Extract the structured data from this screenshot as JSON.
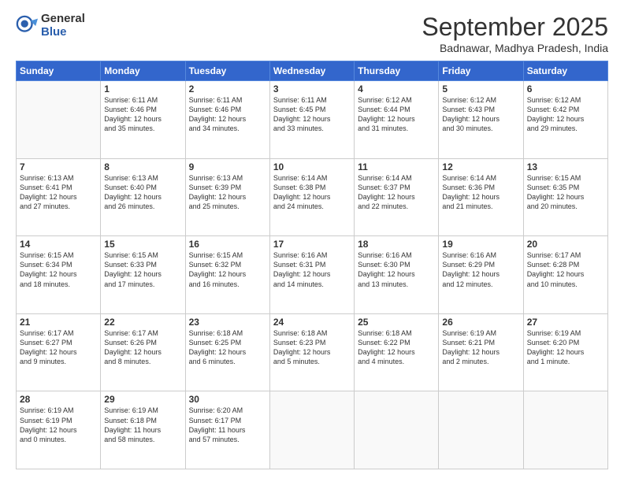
{
  "logo": {
    "general": "General",
    "blue": "Blue"
  },
  "title": "September 2025",
  "location": "Badnawar, Madhya Pradesh, India",
  "days_header": [
    "Sunday",
    "Monday",
    "Tuesday",
    "Wednesday",
    "Thursday",
    "Friday",
    "Saturday"
  ],
  "weeks": [
    [
      {
        "day": "",
        "info": ""
      },
      {
        "day": "1",
        "info": "Sunrise: 6:11 AM\nSunset: 6:46 PM\nDaylight: 12 hours\nand 35 minutes."
      },
      {
        "day": "2",
        "info": "Sunrise: 6:11 AM\nSunset: 6:46 PM\nDaylight: 12 hours\nand 34 minutes."
      },
      {
        "day": "3",
        "info": "Sunrise: 6:11 AM\nSunset: 6:45 PM\nDaylight: 12 hours\nand 33 minutes."
      },
      {
        "day": "4",
        "info": "Sunrise: 6:12 AM\nSunset: 6:44 PM\nDaylight: 12 hours\nand 31 minutes."
      },
      {
        "day": "5",
        "info": "Sunrise: 6:12 AM\nSunset: 6:43 PM\nDaylight: 12 hours\nand 30 minutes."
      },
      {
        "day": "6",
        "info": "Sunrise: 6:12 AM\nSunset: 6:42 PM\nDaylight: 12 hours\nand 29 minutes."
      }
    ],
    [
      {
        "day": "7",
        "info": "Sunrise: 6:13 AM\nSunset: 6:41 PM\nDaylight: 12 hours\nand 27 minutes."
      },
      {
        "day": "8",
        "info": "Sunrise: 6:13 AM\nSunset: 6:40 PM\nDaylight: 12 hours\nand 26 minutes."
      },
      {
        "day": "9",
        "info": "Sunrise: 6:13 AM\nSunset: 6:39 PM\nDaylight: 12 hours\nand 25 minutes."
      },
      {
        "day": "10",
        "info": "Sunrise: 6:14 AM\nSunset: 6:38 PM\nDaylight: 12 hours\nand 24 minutes."
      },
      {
        "day": "11",
        "info": "Sunrise: 6:14 AM\nSunset: 6:37 PM\nDaylight: 12 hours\nand 22 minutes."
      },
      {
        "day": "12",
        "info": "Sunrise: 6:14 AM\nSunset: 6:36 PM\nDaylight: 12 hours\nand 21 minutes."
      },
      {
        "day": "13",
        "info": "Sunrise: 6:15 AM\nSunset: 6:35 PM\nDaylight: 12 hours\nand 20 minutes."
      }
    ],
    [
      {
        "day": "14",
        "info": "Sunrise: 6:15 AM\nSunset: 6:34 PM\nDaylight: 12 hours\nand 18 minutes."
      },
      {
        "day": "15",
        "info": "Sunrise: 6:15 AM\nSunset: 6:33 PM\nDaylight: 12 hours\nand 17 minutes."
      },
      {
        "day": "16",
        "info": "Sunrise: 6:15 AM\nSunset: 6:32 PM\nDaylight: 12 hours\nand 16 minutes."
      },
      {
        "day": "17",
        "info": "Sunrise: 6:16 AM\nSunset: 6:31 PM\nDaylight: 12 hours\nand 14 minutes."
      },
      {
        "day": "18",
        "info": "Sunrise: 6:16 AM\nSunset: 6:30 PM\nDaylight: 12 hours\nand 13 minutes."
      },
      {
        "day": "19",
        "info": "Sunrise: 6:16 AM\nSunset: 6:29 PM\nDaylight: 12 hours\nand 12 minutes."
      },
      {
        "day": "20",
        "info": "Sunrise: 6:17 AM\nSunset: 6:28 PM\nDaylight: 12 hours\nand 10 minutes."
      }
    ],
    [
      {
        "day": "21",
        "info": "Sunrise: 6:17 AM\nSunset: 6:27 PM\nDaylight: 12 hours\nand 9 minutes."
      },
      {
        "day": "22",
        "info": "Sunrise: 6:17 AM\nSunset: 6:26 PM\nDaylight: 12 hours\nand 8 minutes."
      },
      {
        "day": "23",
        "info": "Sunrise: 6:18 AM\nSunset: 6:25 PM\nDaylight: 12 hours\nand 6 minutes."
      },
      {
        "day": "24",
        "info": "Sunrise: 6:18 AM\nSunset: 6:23 PM\nDaylight: 12 hours\nand 5 minutes."
      },
      {
        "day": "25",
        "info": "Sunrise: 6:18 AM\nSunset: 6:22 PM\nDaylight: 12 hours\nand 4 minutes."
      },
      {
        "day": "26",
        "info": "Sunrise: 6:19 AM\nSunset: 6:21 PM\nDaylight: 12 hours\nand 2 minutes."
      },
      {
        "day": "27",
        "info": "Sunrise: 6:19 AM\nSunset: 6:20 PM\nDaylight: 12 hours\nand 1 minute."
      }
    ],
    [
      {
        "day": "28",
        "info": "Sunrise: 6:19 AM\nSunset: 6:19 PM\nDaylight: 12 hours\nand 0 minutes."
      },
      {
        "day": "29",
        "info": "Sunrise: 6:19 AM\nSunset: 6:18 PM\nDaylight: 11 hours\nand 58 minutes."
      },
      {
        "day": "30",
        "info": "Sunrise: 6:20 AM\nSunset: 6:17 PM\nDaylight: 11 hours\nand 57 minutes."
      },
      {
        "day": "",
        "info": ""
      },
      {
        "day": "",
        "info": ""
      },
      {
        "day": "",
        "info": ""
      },
      {
        "day": "",
        "info": ""
      }
    ]
  ]
}
